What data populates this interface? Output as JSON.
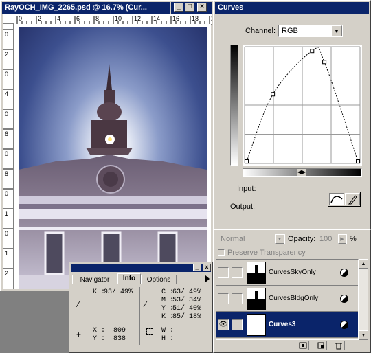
{
  "document": {
    "title": "RayOCH_IMG_2265.psd @ 16.7% (Cur...",
    "ruler_top": [
      "0",
      "2",
      "4",
      "6",
      "8",
      "10",
      "12",
      "14",
      "16",
      "18",
      "20"
    ],
    "ruler_left": [
      "0",
      "2",
      "0",
      "4",
      "0",
      "6",
      "0",
      "8",
      "0",
      "1",
      "0",
      "1",
      "2"
    ]
  },
  "curves": {
    "title": "Curves",
    "channel_label": "Channel:",
    "channel_value": "RGB",
    "input_label": "Input:",
    "output_label": "Output:",
    "points_input": [
      0,
      60,
      150,
      178,
      255
    ],
    "points_output": [
      0,
      152,
      250,
      225,
      0
    ]
  },
  "layers": {
    "blend_mode": "Normal",
    "opacity_label": "Opacity:",
    "opacity_value": "100",
    "opacity_unit": "%",
    "preserve_label": "Preserve Transparency",
    "items": [
      {
        "name": "CurvesSkyOnly",
        "visible": false,
        "selected": false
      },
      {
        "name": "CurvesBldgOnly",
        "visible": false,
        "selected": false
      },
      {
        "name": "Curves3",
        "visible": true,
        "selected": true
      }
    ]
  },
  "info": {
    "tabs": [
      "Navigator",
      "Info",
      "Options"
    ],
    "active_tab": "Info",
    "k_label": "K :",
    "k_value": "93/ 49%",
    "c_label": "C :",
    "c_value": "63/ 49%",
    "m_label": "M :",
    "m_value": "53/ 34%",
    "y_label": "Y :",
    "y_value": "51/ 40%",
    "k2_label": "K :",
    "k2_value": "85/ 18%",
    "x_label": "X :",
    "x_value": "809",
    "yy_label": "Y :",
    "yy_value": "838",
    "w_label": "W :",
    "h_label": "H :"
  }
}
